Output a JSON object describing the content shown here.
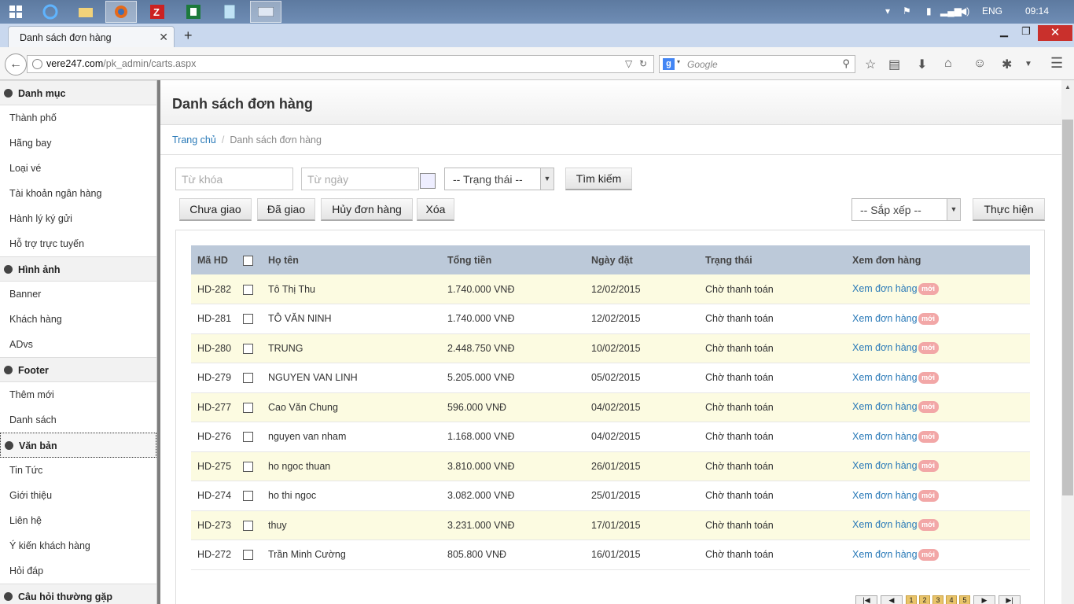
{
  "taskbar": {
    "language": "ENG",
    "clock": "09:14"
  },
  "browser": {
    "tab_title": "Danh sách đơn hàng",
    "url_host": "vere247.com",
    "url_path": "/pk_admin/carts.aspx",
    "search_engine_letter": "g",
    "search_placeholder": "Google"
  },
  "sidebar": {
    "sections": [
      {
        "title": "Danh mục",
        "items": [
          "Thành phố",
          "Hãng bay",
          "Loại vé",
          "Tài khoản ngân hàng",
          "Hành lý ký gửi",
          "Hỗ trợ trực tuyến"
        ]
      },
      {
        "title": "Hình ảnh",
        "items": [
          "Banner",
          "Khách hàng",
          "ADvs"
        ]
      },
      {
        "title": "Footer",
        "items": [
          "Thêm mới",
          "Danh sách"
        ]
      },
      {
        "title": "Văn bản",
        "items": [
          "Tin Tức",
          "Giới thiệu",
          "Liên hệ",
          "Ý kiến khách hàng",
          "Hỏi đáp"
        ]
      },
      {
        "title": "Câu hỏi thường gặp",
        "items": []
      }
    ]
  },
  "page": {
    "title": "Danh sách đơn hàng",
    "breadcrumb_home": "Trang chủ",
    "breadcrumb_current": "Danh sách đơn hàng"
  },
  "filters": {
    "keyword_placeholder": "Từ khóa",
    "date_placeholder": "Từ ngày",
    "status_select": "-- Trạng thái --",
    "search_button": "Tìm kiếm"
  },
  "actions": {
    "not_delivered": "Chưa giao",
    "delivered": "Đã giao",
    "cancel_order": "Hủy đơn hàng",
    "delete": "Xóa",
    "sort_select": "-- Sắp xếp --",
    "execute": "Thực hiện"
  },
  "table": {
    "columns": [
      "Mã HD",
      "",
      "Họ tên",
      "Tổng tiền",
      "Ngày đặt",
      "Trạng thái",
      "Xem đơn hàng"
    ],
    "new_badge": "mới",
    "rows": [
      {
        "id": "HD-282",
        "name": "Tô Thị Thu",
        "total": "1.740.000 VNĐ",
        "date": "12/02/2015",
        "status": "Chờ thanh toán",
        "view": "Xem đơn hàng"
      },
      {
        "id": "HD-281",
        "name": "TÔ VĂN NINH",
        "total": "1.740.000 VNĐ",
        "date": "12/02/2015",
        "status": "Chờ thanh toán",
        "view": "Xem đơn hàng"
      },
      {
        "id": "HD-280",
        "name": "TRUNG",
        "total": "2.448.750 VNĐ",
        "date": "10/02/2015",
        "status": "Chờ thanh toán",
        "view": "Xem đơn hàng"
      },
      {
        "id": "HD-279",
        "name": "NGUYEN VAN LINH",
        "total": "5.205.000 VNĐ",
        "date": "05/02/2015",
        "status": "Chờ thanh toán",
        "view": "Xem đơn hàng"
      },
      {
        "id": "HD-277",
        "name": "Cao Văn Chung",
        "total": "596.000 VNĐ",
        "date": "04/02/2015",
        "status": "Chờ thanh toán",
        "view": "Xem đơn hàng"
      },
      {
        "id": "HD-276",
        "name": "nguyen van nham",
        "total": "1.168.000 VNĐ",
        "date": "04/02/2015",
        "status": "Chờ thanh toán",
        "view": "Xem đơn hàng"
      },
      {
        "id": "HD-275",
        "name": "ho ngoc thuan",
        "total": "3.810.000 VNĐ",
        "date": "26/01/2015",
        "status": "Chờ thanh toán",
        "view": "Xem đơn hàng"
      },
      {
        "id": "HD-274",
        "name": "ho thi ngoc",
        "total": "3.082.000 VNĐ",
        "date": "25/01/2015",
        "status": "Chờ thanh toán",
        "view": "Xem đơn hàng"
      },
      {
        "id": "HD-273",
        "name": "thuy",
        "total": "3.231.000 VNĐ",
        "date": "17/01/2015",
        "status": "Chờ thanh toán",
        "view": "Xem đơn hàng"
      },
      {
        "id": "HD-272",
        "name": "Trần Minh Cường",
        "total": "805.800 VNĐ",
        "date": "16/01/2015",
        "status": "Chờ thanh toán",
        "view": "Xem đơn hàng"
      }
    ]
  },
  "pagination": {
    "pages": [
      "1",
      "2",
      "3",
      "4",
      "5"
    ]
  },
  "icons": [
    "windows-start-icon",
    "ie-icon",
    "explorer-icon",
    "firefox-icon",
    "filezilla-icon",
    "excel-icon",
    "notepad-icon",
    "keyboard-icon"
  ]
}
